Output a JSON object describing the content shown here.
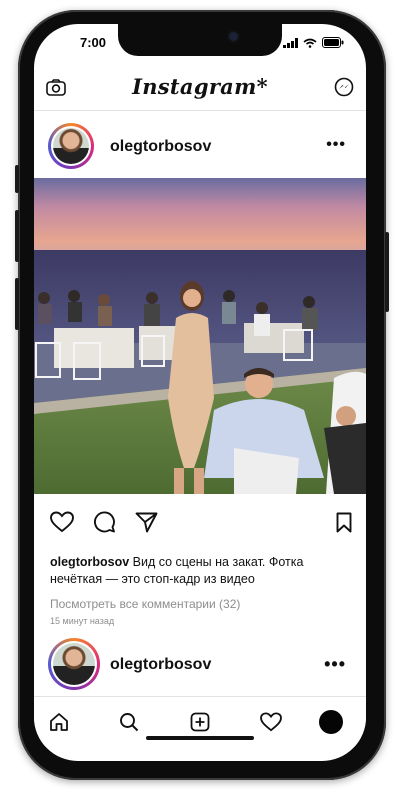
{
  "status": {
    "time": "7:00"
  },
  "header": {
    "logo": "Instagram*",
    "camera_icon": "camera-icon",
    "messenger_icon": "messenger-icon"
  },
  "post": {
    "username": "olegtorbosov",
    "more_icon": "more-icon",
    "caption_text": "Вид со сцены на закат. Фотка нечёткая — это стоп-кадр из видео",
    "view_comments": "Посмотреть все комментарии (32)",
    "timestamp": "15 минут назад"
  },
  "next_post": {
    "username": "olegtorbosov"
  },
  "nav": {
    "items": [
      "home-icon",
      "search-icon",
      "add-icon",
      "heart-icon",
      "profile-avatar"
    ]
  },
  "colors": {
    "separator": "#e2e2e2",
    "muted": "#8e8e8e",
    "story_ring": [
      "#f58529",
      "#dd2a7b",
      "#8134af",
      "#515bd4"
    ]
  }
}
